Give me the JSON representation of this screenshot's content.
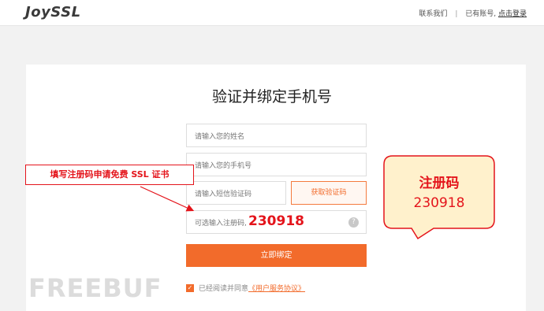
{
  "header": {
    "logo": "JoySSL",
    "contact": "联系我们",
    "separator": "|",
    "have_account": "已有账号,",
    "login_link": "点击登录"
  },
  "form": {
    "title": "验证并绑定手机号",
    "name_placeholder": "请输入您的姓名",
    "phone_placeholder": "请输入您的手机号",
    "sms_placeholder": "请输入短信验证码",
    "sms_button": "获取验证码",
    "code_placeholder": "可选输入注册码,",
    "code_value": "230918",
    "help_icon": "?",
    "submit": "立即绑定",
    "agree_text": "已经阅读并同意",
    "agree_link": "《用户服务协议》"
  },
  "annotations": {
    "left_callout": "填写注册码申请免费 SSL 证书",
    "bubble_title": "注册码",
    "bubble_value": "230918",
    "color": "#e4141b"
  },
  "watermark": "FREEBUF",
  "colors": {
    "accent": "#f26b2b",
    "bubble_fill": "#fff1cc"
  }
}
